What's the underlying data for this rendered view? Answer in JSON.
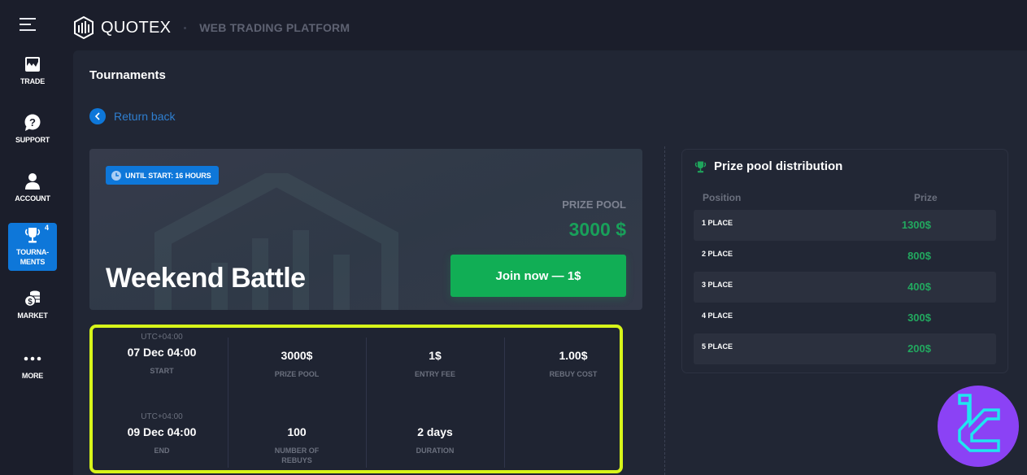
{
  "header": {
    "brand": "QUOTEX",
    "subtitle": "WEB TRADING PLATFORM"
  },
  "sidebar": {
    "items": [
      {
        "label": "TRADE",
        "icon": "chart-image-icon"
      },
      {
        "label": "SUPPORT",
        "icon": "question-bubble-icon"
      },
      {
        "label": "ACCOUNT",
        "icon": "user-icon"
      },
      {
        "label": "TOURNA-\nMENTS",
        "icon": "trophy-icon",
        "badge": "4",
        "active": true
      },
      {
        "label": "MARKET",
        "icon": "coins-icon"
      },
      {
        "label": "MORE",
        "icon": "dots-icon"
      }
    ]
  },
  "page": {
    "title": "Tournaments",
    "return_label": "Return back"
  },
  "tournament": {
    "until_start": "UNTIL START: 16 HOURS",
    "name": "Weekend Battle",
    "prize_pool_label": "PRIZE POOL",
    "prize_pool_value": "3000 $",
    "join_label": "Join now — 1$",
    "accent_green": "#11ae55",
    "accent_blue": "#0e77d9"
  },
  "stats": {
    "highlight_color": "#d7f51a",
    "start": {
      "tz": "UTC+04:00",
      "value": "07 Dec 04:00",
      "caption": "START"
    },
    "prize_pool": {
      "value": "3000$",
      "caption": "PRIZE POOL"
    },
    "entry_fee": {
      "value": "1$",
      "caption": "ENTRY FEE"
    },
    "rebuy_cost": {
      "value": "1.00$",
      "caption": "REBUY COST"
    },
    "end": {
      "tz": "UTC+04:00",
      "value": "09 Dec 04:00",
      "caption": "END"
    },
    "rebuys": {
      "value": "100",
      "caption": "NUMBER OF REBUYS"
    },
    "duration": {
      "value": "2 days",
      "caption": "DURATION"
    }
  },
  "prize_distribution": {
    "title": "Prize pool distribution",
    "col_position": "Position",
    "col_prize": "Prize",
    "rows": [
      {
        "place": "1 PLACE",
        "prize": "1300$"
      },
      {
        "place": "2 PLACE",
        "prize": "800$"
      },
      {
        "place": "3 PLACE",
        "prize": "400$"
      },
      {
        "place": "4 PLACE",
        "prize": "300$"
      },
      {
        "place": "5 PLACE",
        "prize": "200$"
      }
    ]
  }
}
